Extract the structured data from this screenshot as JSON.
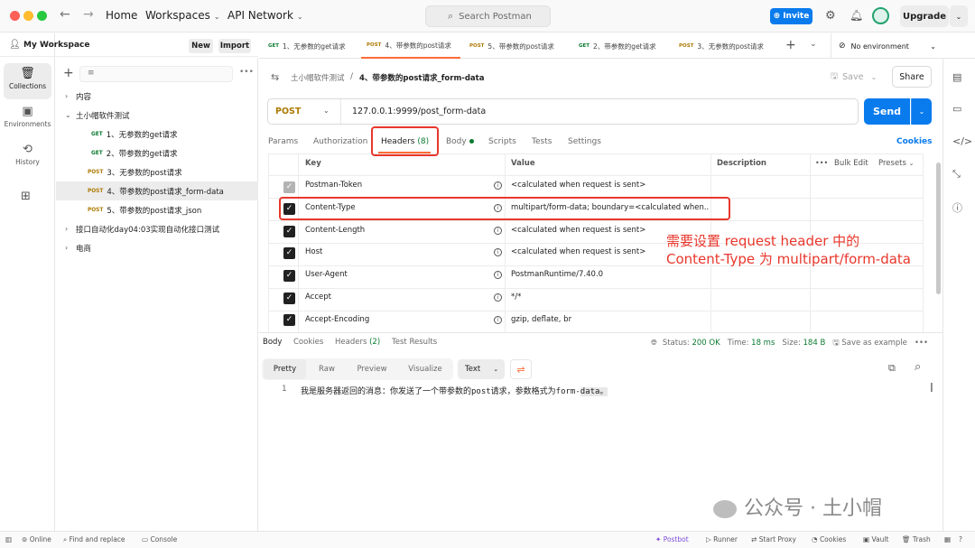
{
  "titlebar": {
    "home": "Home",
    "workspaces": "Workspaces",
    "api_network": "API Network",
    "search_placeholder": "Search Postman",
    "invite": "Invite",
    "upgrade": "Upgrade"
  },
  "rail": {
    "collections": "Collections",
    "environments": "Environments",
    "history": "History"
  },
  "sidebar": {
    "workspace": "My Workspace",
    "new_btn": "New",
    "import_btn": "Import",
    "items": [
      {
        "caret": "›",
        "label": "内容"
      },
      {
        "caret": "⌄",
        "label": "土小帽软件测试"
      },
      {
        "method": "GET",
        "label": "1、无参数的get请求"
      },
      {
        "method": "GET",
        "label": "2、带参数的get请求"
      },
      {
        "method": "POST",
        "label": "3、无参数的post请求"
      },
      {
        "method": "POST",
        "label": "4、带参数的post请求_form-data"
      },
      {
        "method": "POST",
        "label": "5、带参数的post请求_json"
      },
      {
        "caret": "›",
        "label": "接口自动化day04:03实现自动化接口测试"
      },
      {
        "caret": "›",
        "label": "电商"
      }
    ]
  },
  "tabs": [
    {
      "method": "GET",
      "label": "1、无参数的get请求"
    },
    {
      "method": "POST",
      "label": "4、带参数的post请求"
    },
    {
      "method": "POST",
      "label": "5、带参数的post请求"
    },
    {
      "method": "GET",
      "label": "2、带参数的get请求"
    },
    {
      "method": "POST",
      "label": "3、无参数的post请求"
    }
  ],
  "env": "No environment",
  "breadcrumb": {
    "collection": "土小帽软件测试",
    "sep": "/",
    "request": "4、带参数的post请求_form-data"
  },
  "save": "Save",
  "share": "Share",
  "request": {
    "method": "POST",
    "url": "127.0.0.1:9999/post_form-data",
    "send": "Send"
  },
  "req_tabs": {
    "params": "Params",
    "authorization": "Authorization",
    "headers": "Headers",
    "headers_count": "(8)",
    "body": "Body",
    "scripts": "Scripts",
    "tests": "Tests",
    "settings": "Settings",
    "cookies": "Cookies"
  },
  "headers_table": {
    "col_key": "Key",
    "col_value": "Value",
    "col_desc": "Description",
    "more": "•••",
    "bulk_edit": "Bulk Edit",
    "presets": "Presets",
    "rows": [
      {
        "key": "Postman-Token",
        "value": "<calculated when request is sent>",
        "disabled": true
      },
      {
        "key": "Content-Type",
        "value": "multipart/form-data; boundary=<calculated when..."
      },
      {
        "key": "Content-Length",
        "value": "<calculated when request is sent>"
      },
      {
        "key": "Host",
        "value": "<calculated when request is sent>"
      },
      {
        "key": "User-Agent",
        "value": "PostmanRuntime/7.40.0"
      },
      {
        "key": "Accept",
        "value": "*/*"
      },
      {
        "key": "Accept-Encoding",
        "value": "gzip, deflate, br"
      }
    ]
  },
  "annotation": {
    "line1": "需要设置 request header 中的",
    "line2": "Content-Type 为 multipart/form-data"
  },
  "response": {
    "tabs": {
      "body": "Body",
      "cookies": "Cookies",
      "headers": "Headers",
      "headers_count": "(2)",
      "test_results": "Test Results"
    },
    "status_label": "Status:",
    "status": "200 OK",
    "time_label": "Time:",
    "time": "18 ms",
    "size_label": "Size:",
    "size": "184 B",
    "save_example": "Save as example",
    "formats": [
      "Pretty",
      "Raw",
      "Preview",
      "Visualize"
    ],
    "type": "Text",
    "line_number": "1",
    "line_text": "我是服务器返回的消息：你发送了一个带参数的post请求，参数格式为form-",
    "line_text_hl": "data。"
  },
  "watermark": "公众号 · 土小帽",
  "footer": {
    "online": "Online",
    "find_replace": "Find and replace",
    "console": "Console",
    "postbot": "Postbot",
    "runner": "Runner",
    "proxy": "Start Proxy",
    "cookies": "Cookies",
    "vault": "Vault",
    "trash": "Trash"
  },
  "colors": {
    "accent": "#ff6c37",
    "primary": "#097bed",
    "get": "#0a7a2f",
    "post": "#ad7a03",
    "annotation": "#e8372c"
  }
}
